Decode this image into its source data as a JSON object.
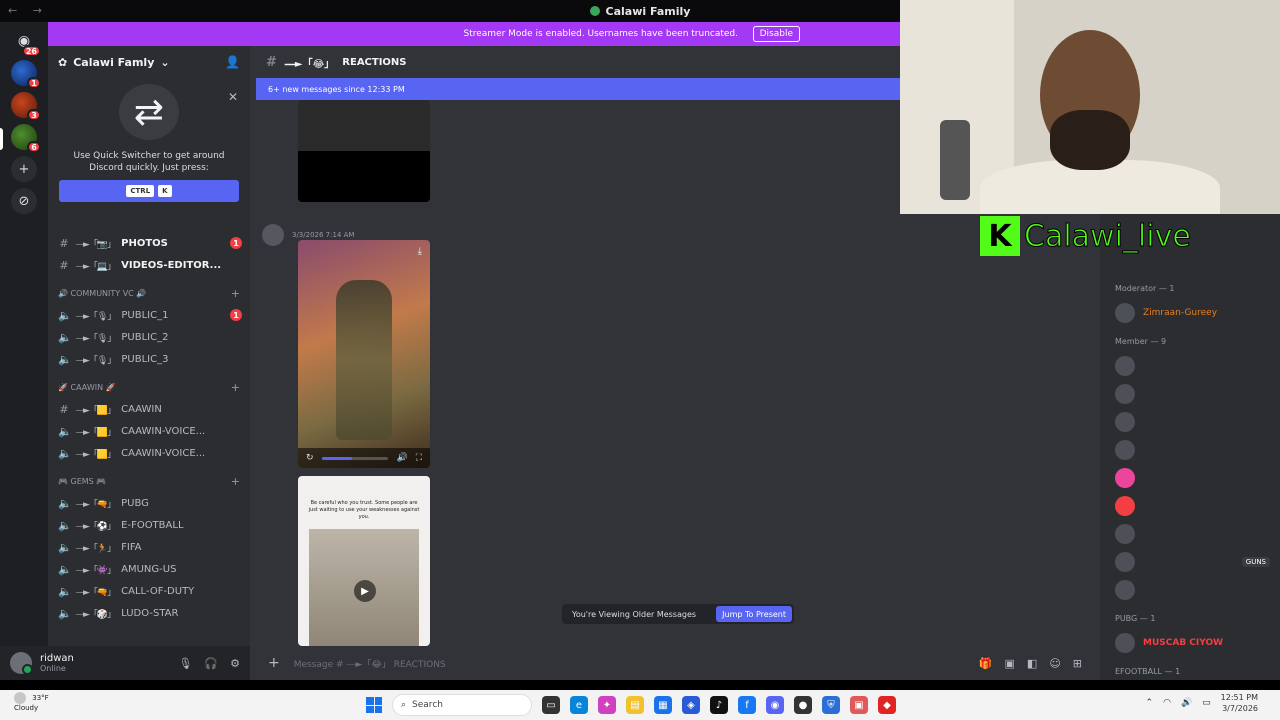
{
  "window": {
    "title": "Calawi Family"
  },
  "banner": {
    "text": "Streamer Mode is enabled. Usernames have been truncated.",
    "button": "Disable"
  },
  "servers": [
    {
      "name": "home",
      "badge": "26"
    },
    {
      "name": "server-1",
      "badge": "1"
    },
    {
      "name": "server-2",
      "badge": "3"
    },
    {
      "name": "server-3",
      "badge": "6"
    }
  ],
  "guild": {
    "name": "Calawi Famly"
  },
  "switcher": {
    "text": "Use Quick Switcher to get around Discord quickly. Just press:",
    "key1": "CTRL",
    "key2": "K"
  },
  "channels": [
    {
      "type": "text",
      "deco": "⎯⎯►「📷」",
      "name": "PHOTOS",
      "badge": "1",
      "unread": true
    },
    {
      "type": "text",
      "deco": "⎯⎯►「💻」",
      "name": "VIDEOS-EDITOR...",
      "badge": "",
      "unread": true
    }
  ],
  "categories": [
    {
      "name": "🔊 COMMUNITY VC 🔊",
      "channels": [
        {
          "type": "voice",
          "deco": "⎯⎯►「🎙」",
          "name": "PUBLIC_1",
          "badge": "1"
        },
        {
          "type": "voice",
          "deco": "⎯⎯►「🎙」",
          "name": "PUBLIC_2",
          "badge": ""
        },
        {
          "type": "voice",
          "deco": "⎯⎯►「🎙」",
          "name": "PUBLIC_3",
          "badge": ""
        }
      ]
    },
    {
      "name": "🚀 CAAWIN 🚀",
      "channels": [
        {
          "type": "text",
          "deco": "⎯⎯►「🟨」",
          "name": "CAAWIN",
          "badge": ""
        },
        {
          "type": "voice",
          "deco": "⎯⎯►「🟨」",
          "name": "CAAWIN-VOICE...",
          "badge": ""
        },
        {
          "type": "voice",
          "deco": "⎯⎯►「🟨」",
          "name": "CAAWIN-VOICE...",
          "badge": ""
        }
      ]
    },
    {
      "name": "🎮 GEMS 🎮",
      "channels": [
        {
          "type": "voice",
          "deco": "⎯⎯►「🔫」",
          "name": "PUBG",
          "badge": ""
        },
        {
          "type": "voice",
          "deco": "⎯⎯►「⚽」",
          "name": "E-FOOTBALL",
          "badge": ""
        },
        {
          "type": "voice",
          "deco": "⎯⎯►「🏃」",
          "name": "FIFA",
          "badge": ""
        },
        {
          "type": "voice",
          "deco": "⎯⎯►「👾」",
          "name": "AMUNG-US",
          "badge": ""
        },
        {
          "type": "voice",
          "deco": "⎯⎯►「🔫」",
          "name": "CALL-OF-DUTY",
          "badge": ""
        },
        {
          "type": "voice",
          "deco": "⎯⎯►「🎲」",
          "name": "LUDO-STAR",
          "badge": ""
        }
      ]
    }
  ],
  "user": {
    "name": "ridwan",
    "status": "Online"
  },
  "channel_header": {
    "deco": "⎯⎯►「😂」",
    "name": "REACTIONS"
  },
  "new_messages": "6+ new messages since 12:33 PM",
  "message": {
    "timestamp": "3/3/2026 7:14 AM"
  },
  "media3_quote": "Be careful who you trust. Some people are just waiting to use your weaknesses against you.",
  "older": {
    "text": "You're Viewing Older Messages",
    "button": "Jump To Present"
  },
  "composer": {
    "placeholder": "Message # ⎯⎯►「😂」 REACTIONS"
  },
  "members": {
    "moderator_header": "Moderator — 1",
    "moderator": "Zimraan-Gureey",
    "member_header": "Member — 9",
    "guns_tag": "GUNS",
    "pubg_header": "PUBG — 1",
    "pubg_member": "MUSCAB CIYOW",
    "efootball_header": "EFOOTBALL — 1"
  },
  "overlay": {
    "kick_logo": "K",
    "kick_name": "Calawi_live"
  },
  "taskbar": {
    "temp": "33°F",
    "condition": "Cloudy",
    "search": "Search",
    "time": "12:51 PM",
    "date": "3/7/2026"
  }
}
